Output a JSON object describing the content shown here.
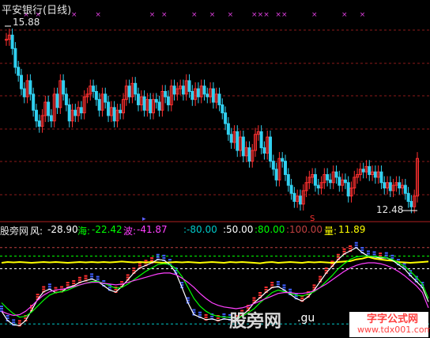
{
  "header": {
    "title": "平安银行(日线)",
    "high_label": "15.88",
    "low_label": "12.48"
  },
  "indicator": {
    "name": "股旁网",
    "feng_label": "风:",
    "feng_value": "-28.90",
    "hai_label": "海:",
    "hai_value": "-22.42",
    "bo_label": "波:",
    "bo_value": "-41.87",
    "ref1": ":-80.00",
    "ref2": ":50.00",
    "ref3": ":80.00",
    "ref4": ":100.00",
    "liang_label": "量:",
    "liang_value": "11.89",
    "colors": {
      "feng": "#ffffff",
      "hai": "#00ff00",
      "bo": "#ff40ff",
      "ref1": "#00c8c8",
      "ref2": "#ffffff",
      "ref3": "#00ff00",
      "ref4": "#c04040",
      "liang": "#ffff00"
    }
  },
  "watermark": {
    "site1": "股旁网",
    "site2": ".gu",
    "site3": "字字公式网",
    "site4": "www.tdx001.com"
  },
  "chart_data": {
    "type": "candlestick",
    "price_range": [
      12.4,
      16.0
    ],
    "prices": [
      15.62,
      15.7,
      15.45,
      15.1,
      14.95,
      14.7,
      14.55,
      14.85,
      14.6,
      14.3,
      14.1,
      14.0,
      14.2,
      14.45,
      14.2,
      14.1,
      14.6,
      14.35,
      14.85,
      14.6,
      14.4,
      14.1,
      14.3,
      14.2,
      14.35,
      14.25,
      14.55,
      14.6,
      14.75,
      14.65,
      14.5,
      14.3,
      14.6,
      14.45,
      14.2,
      14.35,
      14.1,
      14.3,
      14.25,
      14.5,
      14.75,
      14.55,
      14.8,
      14.6,
      14.4,
      14.55,
      14.3,
      14.5,
      14.25,
      14.5,
      14.45,
      14.3,
      14.65,
      14.55,
      14.4,
      14.75,
      14.6,
      14.7,
      14.75,
      14.6,
      14.85,
      14.65,
      14.5,
      14.7,
      14.55,
      14.75,
      14.6,
      14.55,
      14.7,
      14.45,
      14.6,
      14.4,
      14.25,
      14.05,
      13.85,
      13.7,
      13.9,
      13.55,
      13.8,
      13.45,
      13.6,
      13.35,
      13.55,
      13.85,
      13.9,
      13.6,
      13.5,
      13.8,
      13.35,
      13.2,
      13.0,
      13.4,
      13.35,
      13.1,
      12.9,
      12.75,
      12.6,
      12.7,
      12.55,
      12.8,
      12.95,
      13.05,
      13.1,
      12.9,
      12.85,
      12.95,
      13.1,
      13.0,
      12.95,
      13.15,
      13.05,
      12.9,
      13.0,
      12.95,
      12.7,
      12.85,
      13.05,
      13.1,
      13.2,
      13.15,
      13.25,
      13.1,
      13.15,
      13.05,
      13.15,
      12.95,
      12.85,
      12.95,
      12.8,
      12.9,
      12.95,
      12.85,
      12.9,
      12.75,
      12.6,
      12.5,
      12.7,
      13.4
    ],
    "cross_markers": [
      2,
      4,
      10,
      14,
      23,
      25,
      30,
      33,
      36,
      40,
      41,
      42,
      44,
      45,
      50,
      55,
      58
    ],
    "indicator_bounds": [
      -100,
      120
    ],
    "hlines": [
      {
        "value": 100,
        "color": "#c04040"
      },
      {
        "value": 80,
        "color": "#00ff00"
      },
      {
        "value": 50,
        "color": "#ffffff"
      },
      {
        "value": -80,
        "color": "#00c8c8"
      }
    ],
    "series": [
      {
        "name": "量",
        "color": "#ffff00",
        "values": [
          64,
          66,
          65,
          66,
          65,
          64,
          65,
          66,
          65,
          66,
          65,
          64,
          65,
          66,
          65,
          66,
          65,
          66,
          65,
          66,
          67,
          66,
          65,
          66,
          65,
          66,
          65,
          64,
          65,
          66,
          65,
          66,
          65,
          64,
          65,
          66,
          65,
          64,
          66,
          65,
          66,
          65,
          64,
          63,
          65,
          66,
          64,
          65,
          66,
          65,
          64,
          66,
          65,
          66,
          65,
          64,
          66,
          67,
          68,
          72,
          74,
          78,
          74,
          72,
          70,
          69,
          66,
          65,
          64,
          65,
          66,
          67
        ]
      },
      {
        "name": "风",
        "color": "#ffffff",
        "values": [
          -50,
          -72,
          -82,
          -84,
          -72,
          -48,
          -22,
          -4,
          2,
          -6,
          -4,
          6,
          10,
          18,
          22,
          26,
          20,
          10,
          0,
          -5,
          8,
          24,
          40,
          52,
          58,
          64,
          72,
          70,
          60,
          40,
          6,
          -30,
          -58,
          -64,
          -70,
          -68,
          -72,
          -68,
          -70,
          -72,
          -60,
          -48,
          -30,
          -18,
          -5,
          6,
          8,
          0,
          -10,
          -20,
          -26,
          -16,
          0,
          20,
          40,
          56,
          72,
          85,
          92,
          100,
          88,
          80,
          78,
          75,
          76,
          70,
          60,
          50,
          34,
          20,
          6,
          -28
        ]
      },
      {
        "name": "海",
        "color": "#00ff00",
        "values": [
          -30,
          -44,
          -56,
          -64,
          -62,
          -52,
          -38,
          -24,
          -12,
          -6,
          -4,
          0,
          6,
          12,
          16,
          20,
          20,
          16,
          10,
          4,
          6,
          14,
          24,
          34,
          44,
          52,
          60,
          62,
          60,
          50,
          32,
          6,
          -20,
          -38,
          -50,
          -58,
          -62,
          -64,
          -64,
          -66,
          -62,
          -54,
          -44,
          -30,
          -18,
          -6,
          0,
          -4,
          -8,
          -12,
          -14,
          -10,
          -4,
          6,
          20,
          34,
          50,
          62,
          72,
          78,
          80,
          80,
          79,
          78,
          76,
          72,
          64,
          56,
          44,
          30,
          14,
          -20
        ]
      },
      {
        "name": "波",
        "color": "#ff40ff",
        "values": [
          -50,
          -56,
          -60,
          -58,
          -50,
          -38,
          -24,
          -12,
          -4,
          0,
          2,
          4,
          8,
          12,
          16,
          18,
          18,
          16,
          14,
          12,
          14,
          18,
          22,
          26,
          30,
          34,
          38,
          40,
          40,
          36,
          28,
          18,
          6,
          -8,
          -20,
          -30,
          -36,
          -40,
          -42,
          -44,
          -42,
          -38,
          -32,
          -26,
          -20,
          -14,
          -8,
          -6,
          -6,
          -8,
          -8,
          -6,
          -2,
          6,
          14,
          24,
          34,
          44,
          52,
          58,
          62,
          64,
          64,
          62,
          58,
          52,
          44,
          34,
          22,
          10,
          -6,
          -42
        ]
      }
    ]
  }
}
